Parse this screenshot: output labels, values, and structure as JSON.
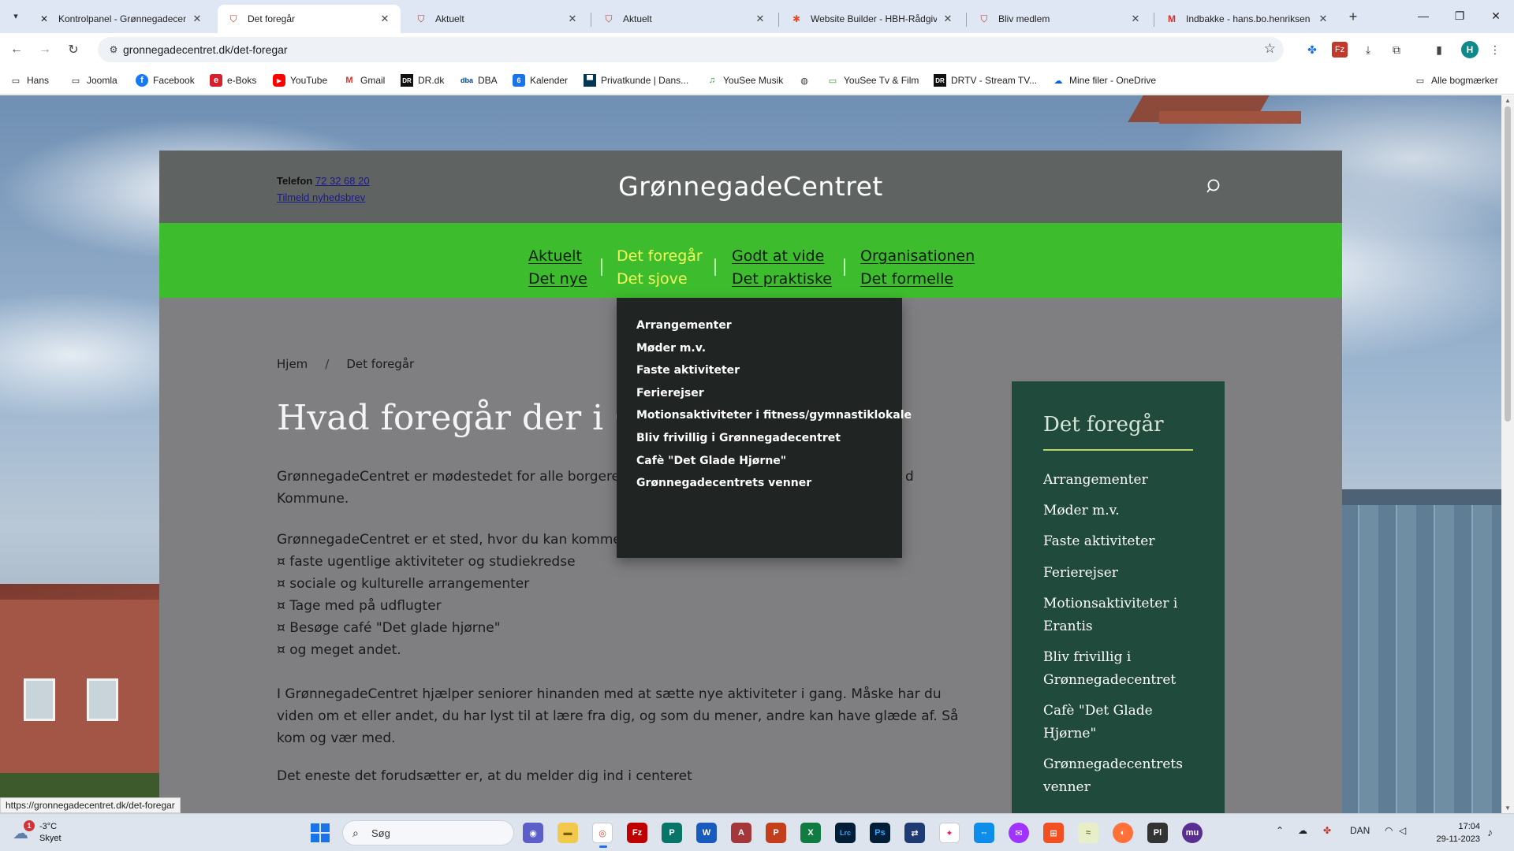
{
  "browser": {
    "tabs": [
      {
        "title": "Kontrolpanel - Grønnegadecen",
        "icon": "joomla-icon",
        "active": false
      },
      {
        "title": "Det foregår",
        "icon": "shield-icon",
        "active": true
      },
      {
        "title": "Aktuelt",
        "icon": "shield-icon",
        "active": false
      },
      {
        "title": "Aktuelt",
        "icon": "shield-icon",
        "active": false
      },
      {
        "title": "Website Builder - HBH-Rådgiv",
        "icon": "builder-icon",
        "active": false
      },
      {
        "title": "Bliv medlem",
        "icon": "shield-icon",
        "active": false
      },
      {
        "title": "Indbakke - hans.bo.henriksen",
        "icon": "gmail-icon",
        "active": false
      }
    ],
    "url": "gronnegadecentret.dk/det-foregar",
    "profile_initial": "H",
    "bookmarks": [
      {
        "label": "Hans",
        "icon": "folder-icon"
      },
      {
        "label": "Joomla",
        "icon": "folder-icon"
      },
      {
        "label": "Facebook",
        "icon": "facebook-icon"
      },
      {
        "label": "e-Boks",
        "icon": "eboks-icon"
      },
      {
        "label": "YouTube",
        "icon": "youtube-icon"
      },
      {
        "label": "Gmail",
        "icon": "gmail-icon"
      },
      {
        "label": "DR.dk",
        "icon": "dr-icon"
      },
      {
        "label": "DBA",
        "icon": "dba-icon"
      },
      {
        "label": "Kalender",
        "icon": "calendar-icon"
      },
      {
        "label": "Privatkunde | Dans...",
        "icon": "bank-icon"
      },
      {
        "label": "YouSee Musik",
        "icon": "music-icon"
      },
      {
        "label": "",
        "icon": "globe-icon"
      },
      {
        "label": "YouSee Tv & Film",
        "icon": "tv-icon"
      },
      {
        "label": "DRTV - Stream TV...",
        "icon": "drtv-icon"
      },
      {
        "label": "Mine filer - OneDrive",
        "icon": "onedrive-icon"
      }
    ],
    "all_bookmarks": "Alle bogmærker",
    "status_url": "https://gronnegadecentret.dk/det-foregar"
  },
  "site": {
    "phone_label": "Telefon",
    "phone_number": "72 32 68 20",
    "newsletter_link": "Tilmeld nyhedsbrev",
    "brand": "GrønnegadeCentret",
    "nav": [
      {
        "line1": "Aktuelt",
        "line2": "Det nye",
        "active": false
      },
      {
        "line1": "Det foregår",
        "line2": "Det sjove",
        "active": true
      },
      {
        "line1": "Godt at vide",
        "line2": "Det praktiske",
        "active": false
      },
      {
        "line1": "Organisationen",
        "line2": "Det formelle",
        "active": false
      }
    ],
    "dropdown": [
      "Arrangementer",
      "Møder m.v.",
      "Faste aktiviteter",
      "Ferierejser",
      "Motionsaktiviteter i fitness/gymnastiklokale",
      "Bliv frivillig i Grønnegadecentret",
      "Cafè \"Det Glade Hjørne\"",
      "Grønnegadecentrets venner"
    ],
    "breadcrumb": {
      "home": "Hjem",
      "separator": "/",
      "current": "Det foregår"
    },
    "page_title": "Hvad foregår der i Grøn",
    "intro_line1": "GrønnegadeCentret er mødestedet for alle borgere",
    "intro_line1_tail": "d",
    "intro_line2": "Kommune.",
    "list_intro": "GrønnegadeCentret er et sted, hvor du kan komme",
    "list_items": [
      "¤ faste ugentlige aktiviteter og studiekredse",
      "¤ sociale og kulturelle arrangementer",
      "¤ Tage med på udflugter",
      "¤ Besøge café \"Det glade hjørne\"",
      "¤ og meget andet."
    ],
    "paragraph3": "I GrønnegadeCentret hjælper seniorer hinanden med at sætte nye aktiviteter i gang. Måske har du viden om et eller andet, du har lyst til at lære fra dig, og som du mener, andre kan have glæde af. Så kom og vær med.",
    "paragraph4": "Det eneste det forudsætter er, at du melder dig ind i centeret",
    "sidebar": {
      "title": "Det foregår",
      "items": [
        "Arrangementer",
        "Møder m.v.",
        "Faste aktiviteter",
        "Ferierejser",
        "Motionsaktiviteter i Erantis",
        "Bliv frivillig i Grønnegadecentret",
        "Cafè \"Det Glade Hjørne\"",
        "Grønnegadecentrets venner"
      ]
    },
    "colors": {
      "header": "#5f6362",
      "nav": "#3dbd2d",
      "nav_active": "#f3ff5a",
      "sidebar": "#1f4a3c",
      "dropdown": "#202523"
    }
  },
  "taskbar": {
    "weather_temp": "-3°C",
    "weather_desc": "Skyet",
    "weather_badge": "1",
    "search_placeholder": "Søg",
    "apps": [
      {
        "name": "meet-app",
        "label": "◉"
      },
      {
        "name": "explorer-app",
        "label": "▬"
      },
      {
        "name": "chrome-app",
        "label": "◎"
      },
      {
        "name": "filezilla-app",
        "label": "Fz"
      },
      {
        "name": "publisher-app",
        "label": "P"
      },
      {
        "name": "word-app",
        "label": "W"
      },
      {
        "name": "access-app",
        "label": "A"
      },
      {
        "name": "powerpoint-app",
        "label": "P"
      },
      {
        "name": "excel-app",
        "label": "X"
      },
      {
        "name": "lightroom-app",
        "label": "Lrc"
      },
      {
        "name": "photoshop-app",
        "label": "Ps"
      },
      {
        "name": "app-12",
        "label": "⇄"
      },
      {
        "name": "app-13",
        "label": "✦"
      },
      {
        "name": "teamviewer-app",
        "label": "⇔"
      },
      {
        "name": "messenger-app",
        "label": "✉"
      },
      {
        "name": "office-app",
        "label": "⊞"
      },
      {
        "name": "app-17",
        "label": "≈"
      },
      {
        "name": "firefox-app",
        "label": "◐"
      },
      {
        "name": "app-19",
        "label": "Pl"
      },
      {
        "name": "app-20",
        "label": "mu"
      }
    ],
    "language": "DAN",
    "time": "17:04",
    "date": "29-11-2023"
  }
}
